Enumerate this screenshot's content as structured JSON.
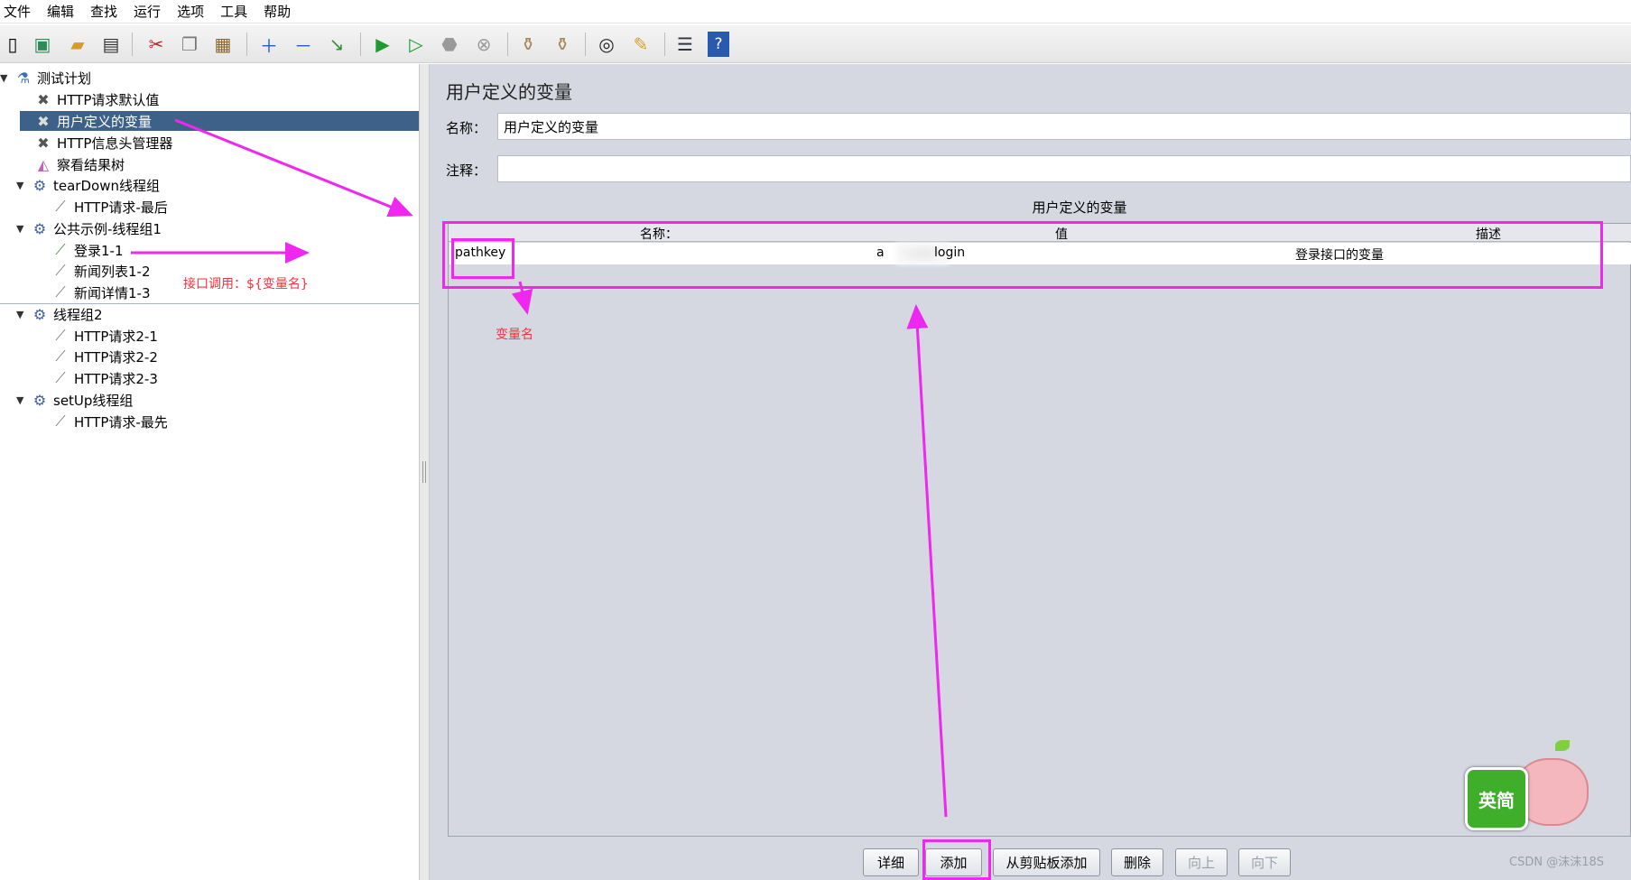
{
  "menu": [
    "文件",
    "编辑",
    "查找",
    "运行",
    "选项",
    "工具",
    "帮助"
  ],
  "toolbar": [
    {
      "icon": "new-icon"
    },
    {
      "icon": "templates-icon"
    },
    {
      "icon": "open-icon"
    },
    {
      "icon": "save-icon"
    },
    {
      "icon": "cut-icon"
    },
    {
      "icon": "copy-icon"
    },
    {
      "icon": "paste-icon"
    },
    {
      "icon": "expand-icon"
    },
    {
      "icon": "collapse-icon"
    },
    {
      "icon": "toggle-icon"
    },
    {
      "icon": "start-icon"
    },
    {
      "icon": "start-no-pause-icon"
    },
    {
      "icon": "stop-icon"
    },
    {
      "icon": "shutdown-icon"
    },
    {
      "icon": "clear-icon"
    },
    {
      "icon": "clear-all-icon"
    },
    {
      "icon": "search-icon"
    },
    {
      "icon": "reset-search-icon"
    },
    {
      "icon": "function-helper-icon"
    },
    {
      "icon": "help-icon"
    }
  ],
  "tree": [
    {
      "label": "测试计划",
      "icon": "test-plan-icon",
      "toggle": "▼"
    },
    {
      "label": "HTTP请求默认值",
      "icon": "config-icon"
    },
    {
      "label": "用户定义的变量",
      "icon": "config-icon",
      "selected": true
    },
    {
      "label": "HTTP信息头管理器",
      "icon": "config-icon"
    },
    {
      "label": "察看结果树",
      "icon": "listener-icon"
    },
    {
      "label": "tearDown线程组",
      "icon": "thread-group-icon",
      "toggle": "▼"
    },
    {
      "label": "HTTP请求-最后",
      "icon": "sampler-icon"
    },
    {
      "label": "公共示例-线程组1",
      "icon": "thread-group-icon",
      "toggle": "▼"
    },
    {
      "label": "登录1-1",
      "icon": "sampler-icon"
    },
    {
      "label": "新闻列表1-2",
      "icon": "sampler-icon"
    },
    {
      "label": "新闻详情1-3",
      "icon": "sampler-icon"
    },
    {
      "label": "线程组2",
      "icon": "thread-group-icon",
      "toggle": "▼"
    },
    {
      "label": "HTTP请求2-1",
      "icon": "sampler-icon"
    },
    {
      "label": "HTTP请求2-2",
      "icon": "sampler-icon"
    },
    {
      "label": "HTTP请求2-3",
      "icon": "sampler-icon"
    },
    {
      "label": "setUp线程组",
      "icon": "thread-group-icon",
      "toggle": "▼"
    },
    {
      "label": "HTTP请求-最先",
      "icon": "sampler-icon"
    }
  ],
  "panel": {
    "title": "用户定义的变量",
    "name_label": "名称：",
    "name_value": "用户定义的变量",
    "comment_label": "注释：",
    "comment_value": "",
    "section_title": "用户定义的变量"
  },
  "table": {
    "headers": [
      "名称：",
      "值",
      "描述"
    ],
    "rows": [
      {
        "name": "pathkey",
        "value_prefix": "a",
        "value_suffix": "login",
        "desc": "登录接口的变量"
      }
    ]
  },
  "buttons": [
    {
      "label": "详细",
      "enabled": true
    },
    {
      "label": "添加",
      "enabled": true
    },
    {
      "label": "从剪贴板添加",
      "enabled": true
    },
    {
      "label": "删除",
      "enabled": true
    },
    {
      "label": "向上",
      "enabled": false
    },
    {
      "label": "向下",
      "enabled": false
    }
  ],
  "annotations": {
    "call_hint": "接口调用：${变量名}",
    "var_name_hint": "变量名"
  },
  "ime_widget": {
    "label": "英简"
  },
  "watermark": "CSDN @沫沫18S",
  "colors": {
    "selection": "#3d6189",
    "highlight": "#ee28ee",
    "annotation_text": "#f2323a",
    "panel_bg": "#d5d8e1"
  }
}
